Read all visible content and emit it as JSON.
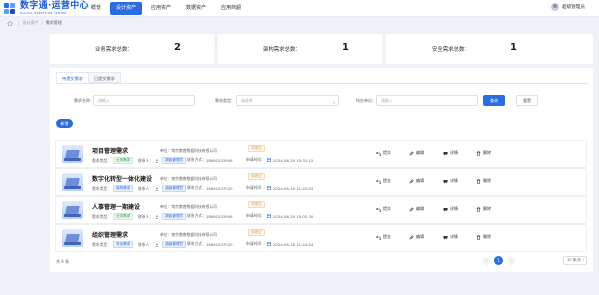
{
  "app": {
    "logo_title": "数字通·运营中心",
    "logo_sub": "DIGITAL OPERATION CENTER",
    "user_name": "超级管理员"
  },
  "nav": [
    {
      "label": "概览",
      "active": false
    },
    {
      "label": "设计资产",
      "active": true
    },
    {
      "label": "应用资产",
      "active": false
    },
    {
      "label": "数据资产",
      "active": false
    },
    {
      "label": "应用商超",
      "active": false
    }
  ],
  "breadcrumb": {
    "root": "设计资产",
    "current": "需求管理"
  },
  "stats": [
    {
      "label": "业务需求总数：",
      "value": "2"
    },
    {
      "label": "架构需求总数：",
      "value": "1"
    },
    {
      "label": "安全需求总数：",
      "value": "1"
    }
  ],
  "tabs": [
    {
      "label": "待提交需求",
      "active": true
    },
    {
      "label": "已提交需求",
      "active": false
    }
  ],
  "filters": {
    "name_label": "需求名称：",
    "name_placeholder": "请输入",
    "type_label": "需求类型：",
    "type_placeholder": "请选择",
    "unit_label": "所在单位：",
    "unit_placeholder": "请输入",
    "search": "查询",
    "reset": "重置"
  },
  "add_button": "新增",
  "row_labels": {
    "type": "需求类型：",
    "contact": "联系人：",
    "phone": "联系方式：",
    "unit": "单位：",
    "date": "申请时间："
  },
  "actions": {
    "submit": "提交",
    "edit": "编辑",
    "detail": "详情",
    "delete": "删除"
  },
  "rows": [
    {
      "title": "项目管理需求",
      "type": "业务需求",
      "type_color": "green",
      "unit": "南京数睿数据科技有限公司",
      "contact": "超级管理员",
      "phone": "18692533958",
      "status": "待提交",
      "date": "2024-06-20 15:31:15"
    },
    {
      "title": "数字化转型一体化建设",
      "type": "架构需求",
      "type_color": "blue",
      "unit": "南京数睿数据科技有限公司",
      "contact": "超级管理员",
      "phone": "18692537520",
      "status": "待提交",
      "date": "2024-06-19 11:42:03"
    },
    {
      "title": "人事管理一期建设",
      "type": "业务需求",
      "type_color": "green",
      "unit": "南京数睿数据科技有限公司",
      "contact": "超级管理员",
      "phone": "18692533958",
      "status": "待提交",
      "date": "2024-06-20 15:02:30"
    },
    {
      "title": "组织管理需求",
      "type": "安全需求",
      "type_color": "blue",
      "unit": "南京数睿数据科技有限公司",
      "contact": "超级管理员",
      "phone": "18692537520",
      "status": "待提交",
      "date": "2024-06-18 11:44:24"
    }
  ],
  "pagination": {
    "total": "共 4 条",
    "page": "1",
    "page_size": "10 条/页"
  }
}
